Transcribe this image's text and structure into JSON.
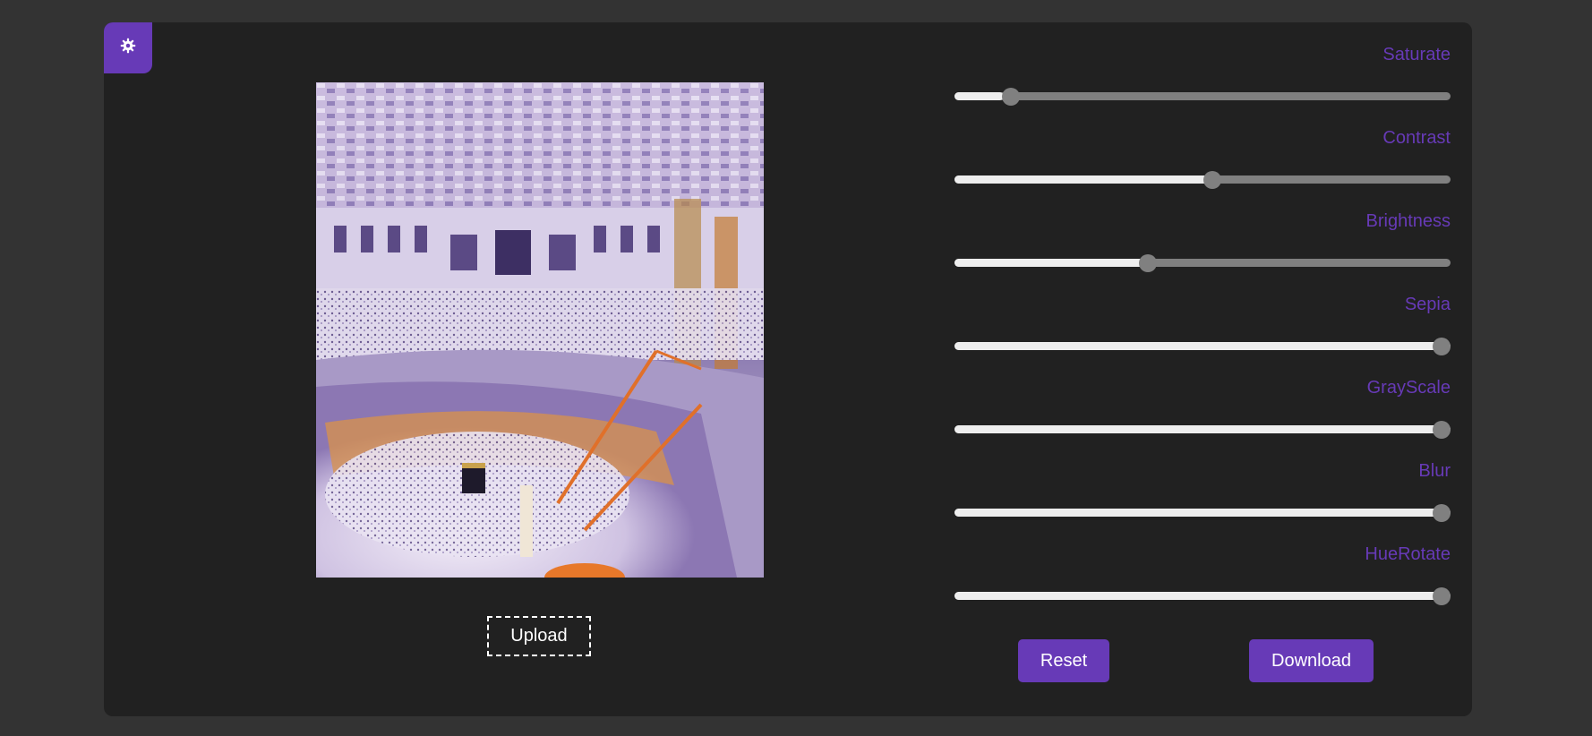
{
  "theme_toggle": {
    "icon": "gear-icon"
  },
  "preview": {
    "upload_label": "Upload"
  },
  "filters": [
    {
      "label": "Saturate",
      "value": 0.1
    },
    {
      "label": "Contrast",
      "value": 0.52
    },
    {
      "label": "Brightness",
      "value": 0.385
    },
    {
      "label": "Sepia",
      "value": 1.0
    },
    {
      "label": "GrayScale",
      "value": 1.0
    },
    {
      "label": "Blur",
      "value": 1.0
    },
    {
      "label": "HueRotate",
      "value": 1.0
    }
  ],
  "actions": {
    "reset_label": "Reset",
    "download_label": "Download"
  },
  "colors": {
    "accent": "#673ab7",
    "panel": "#212121",
    "background": "#333333"
  }
}
